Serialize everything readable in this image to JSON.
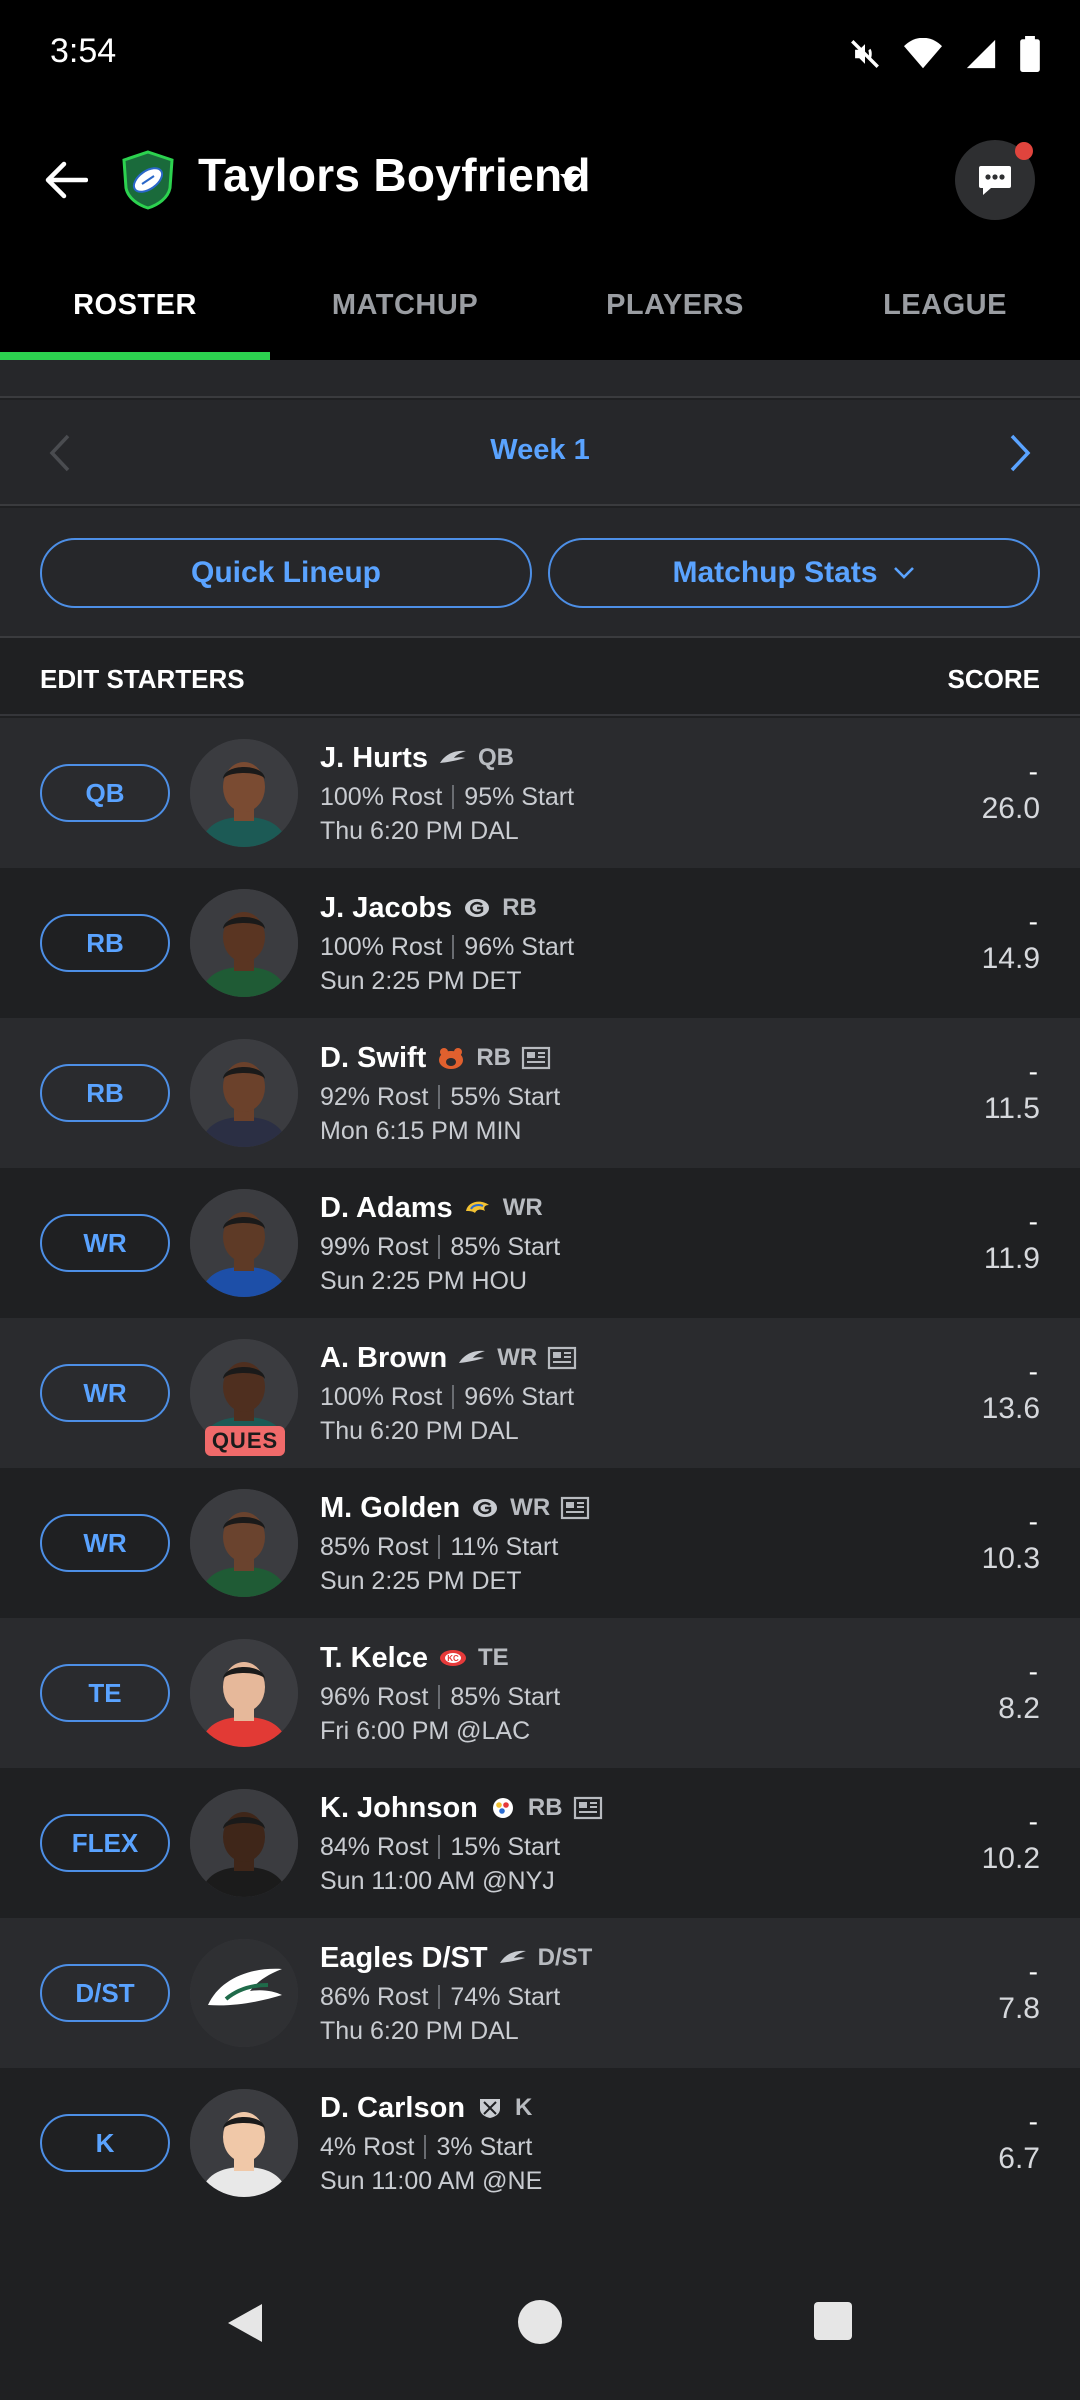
{
  "status_bar": {
    "time": "3:54"
  },
  "header": {
    "team_name": "Taylors Boyfriend"
  },
  "tabs": [
    {
      "label": "ROSTER",
      "active": true
    },
    {
      "label": "MATCHUP",
      "active": false
    },
    {
      "label": "PLAYERS",
      "active": false
    },
    {
      "label": "LEAGUE",
      "active": false
    }
  ],
  "week_nav": {
    "label": "Week 1"
  },
  "actions": {
    "quick_lineup": "Quick Lineup",
    "matchup_stats": "Matchup Stats"
  },
  "section": {
    "left": "EDIT STARTERS",
    "right": "SCORE"
  },
  "roster": [
    {
      "slot": "QB",
      "name": "J. Hurts",
      "team_icon": "eagles-icon",
      "pos": "QB",
      "news": false,
      "rost": "100% Rost",
      "start": "95% Start",
      "game": "Thu 6:20 PM DAL",
      "dash": "-",
      "score": "26.0",
      "status": ""
    },
    {
      "slot": "RB",
      "name": "J. Jacobs",
      "team_icon": "packers-icon",
      "pos": "RB",
      "news": false,
      "rost": "100% Rost",
      "start": "96% Start",
      "game": "Sun 2:25 PM DET",
      "dash": "-",
      "score": "14.9",
      "status": ""
    },
    {
      "slot": "RB",
      "name": "D. Swift",
      "team_icon": "bears-icon",
      "pos": "RB",
      "news": true,
      "rost": "92% Rost",
      "start": "55% Start",
      "game": "Mon 6:15 PM MIN",
      "dash": "-",
      "score": "11.5",
      "status": ""
    },
    {
      "slot": "WR",
      "name": "D. Adams",
      "team_icon": "rams-icon",
      "pos": "WR",
      "news": false,
      "rost": "99% Rost",
      "start": "85% Start",
      "game": "Sun 2:25 PM HOU",
      "dash": "-",
      "score": "11.9",
      "status": ""
    },
    {
      "slot": "WR",
      "name": "A. Brown",
      "team_icon": "eagles-icon",
      "pos": "WR",
      "news": true,
      "rost": "100% Rost",
      "start": "96% Start",
      "game": "Thu 6:20 PM DAL",
      "dash": "-",
      "score": "13.6",
      "status": "QUES"
    },
    {
      "slot": "WR",
      "name": "M. Golden",
      "team_icon": "packers-icon",
      "pos": "WR",
      "news": true,
      "rost": "85% Rost",
      "start": "11% Start",
      "game": "Sun 2:25 PM DET",
      "dash": "-",
      "score": "10.3",
      "status": ""
    },
    {
      "slot": "TE",
      "name": "T. Kelce",
      "team_icon": "chiefs-icon",
      "pos": "TE",
      "news": false,
      "rost": "96% Rost",
      "start": "85% Start",
      "game": "Fri 6:00 PM @LAC",
      "dash": "-",
      "score": "8.2",
      "status": ""
    },
    {
      "slot": "FLEX",
      "name": "K. Johnson",
      "team_icon": "steelers-icon",
      "pos": "RB",
      "news": true,
      "rost": "84% Rost",
      "start": "15% Start",
      "game": "Sun 11:00 AM @NYJ",
      "dash": "-",
      "score": "10.2",
      "status": ""
    },
    {
      "slot": "D/ST",
      "name": "Eagles D/ST",
      "team_icon": "eagles-icon",
      "pos": "D/ST",
      "news": false,
      "rost": "86% Rost",
      "start": "74% Start",
      "game": "Thu 6:20 PM DAL",
      "dash": "-",
      "score": "7.8",
      "status": ""
    },
    {
      "slot": "K",
      "name": "D. Carlson",
      "team_icon": "raiders-icon",
      "pos": "K",
      "news": false,
      "rost": "4% Rost",
      "start": "3% Start",
      "game": "Sun 11:00 AM @NE",
      "dash": "-",
      "score": "6.7",
      "status": ""
    }
  ]
}
